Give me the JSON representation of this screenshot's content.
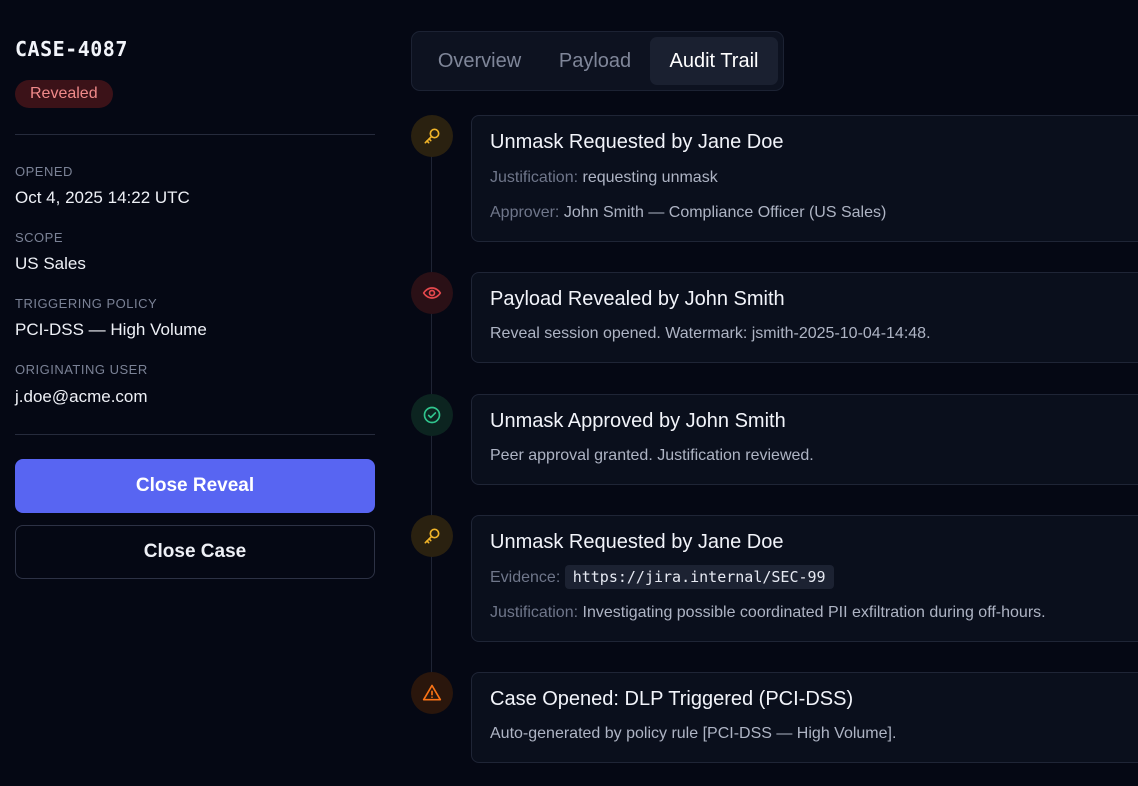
{
  "case": {
    "id": "CASE-4087",
    "status": "Revealed"
  },
  "meta": [
    {
      "label": "OPENED",
      "value": "Oct 4, 2025 14:22 UTC"
    },
    {
      "label": "SCOPE",
      "value": "US Sales"
    },
    {
      "label": "TRIGGERING POLICY",
      "value": "PCI-DSS — High Volume"
    },
    {
      "label": "ORIGINATING USER",
      "value": "j.doe@acme.com"
    }
  ],
  "actions": {
    "close_reveal": "Close Reveal",
    "close_case": "Close Case"
  },
  "tabs": [
    {
      "label": "Overview",
      "active": false
    },
    {
      "label": "Payload",
      "active": false
    },
    {
      "label": "Audit Trail",
      "active": true
    }
  ],
  "events": [
    {
      "icon": "key-icon",
      "color": "#f0b429",
      "title": "Unmask Requested by Jane Doe",
      "lines": [
        {
          "label": "Justification:",
          "value": "requesting unmask"
        },
        {
          "label": "Approver:",
          "value": "John Smith — Compliance Officer (US Sales)"
        }
      ]
    },
    {
      "icon": "eye-icon",
      "color": "#e5484d",
      "title": "Payload Revealed by John Smith",
      "text": "Reveal session opened. Watermark: jsmith-2025-10-04-14:48."
    },
    {
      "icon": "check-circle-icon",
      "color": "#30c48d",
      "title": "Unmask Approved by John Smith",
      "text": "Peer approval granted. Justification reviewed."
    },
    {
      "icon": "key-icon",
      "color": "#f0b429",
      "title": "Unmask Requested by Jane Doe",
      "evidence_label": "Evidence:",
      "evidence_value": "https://jira.internal/SEC-99",
      "lines": [
        {
          "label": "Justification:",
          "value": "Investigating possible coordinated PII exfiltration during off-hours."
        }
      ]
    },
    {
      "icon": "warning-icon",
      "color": "#f97316",
      "title": "Case Opened: DLP Triggered (PCI-DSS)",
      "text": "Auto-generated by policy rule [PCI-DSS — High Volume]."
    }
  ],
  "colors": {
    "background": "#050814",
    "accent": "#5865f2",
    "badge_bg": "#3b1218",
    "badge_text": "#f08a8a"
  }
}
